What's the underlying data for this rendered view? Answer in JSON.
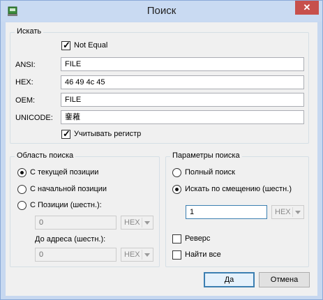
{
  "window": {
    "title": "Поиск",
    "close_glyph": "✕"
  },
  "search_group": {
    "title": "Искать",
    "not_equal": {
      "label": "Not Equal",
      "checked": true
    },
    "ansi": {
      "label": "ANSI:",
      "value": "FILE"
    },
    "hex": {
      "label": "HEX:",
      "value": "46 49 4c 45"
    },
    "oem": {
      "label": "OEM:",
      "value": "FILE"
    },
    "unicode": {
      "label": "UNICODE:",
      "value": "䥆䕌"
    },
    "case_sensitive": {
      "label": "Учитывать регистр",
      "checked": true
    }
  },
  "scope_group": {
    "title": "Область поиска",
    "options": [
      {
        "label": "С текущей позиции",
        "selected": true
      },
      {
        "label": "С начальной позиции",
        "selected": false
      },
      {
        "label": "С Позиции (шестн.):",
        "selected": false
      }
    ],
    "from_value": "0",
    "from_format": "HEX",
    "to_label": "До адреса (шестн.):",
    "to_value": "0",
    "to_format": "HEX"
  },
  "params_group": {
    "title": "Параметры поиска",
    "options": [
      {
        "label": "Полный поиск",
        "selected": false
      },
      {
        "label": "Искать по смещению (шестн.)",
        "selected": true
      }
    ],
    "offset_value": "1",
    "offset_format": "HEX",
    "reverse": {
      "label": "Реверс",
      "checked": false
    },
    "find_all": {
      "label": "Найти все",
      "checked": false
    }
  },
  "buttons": {
    "ok": "Да",
    "cancel": "Отмена"
  },
  "colors": {
    "close_red": "#c7504c",
    "title_bar": "#c9daf2",
    "focus_blue": "#3c7fb1"
  }
}
